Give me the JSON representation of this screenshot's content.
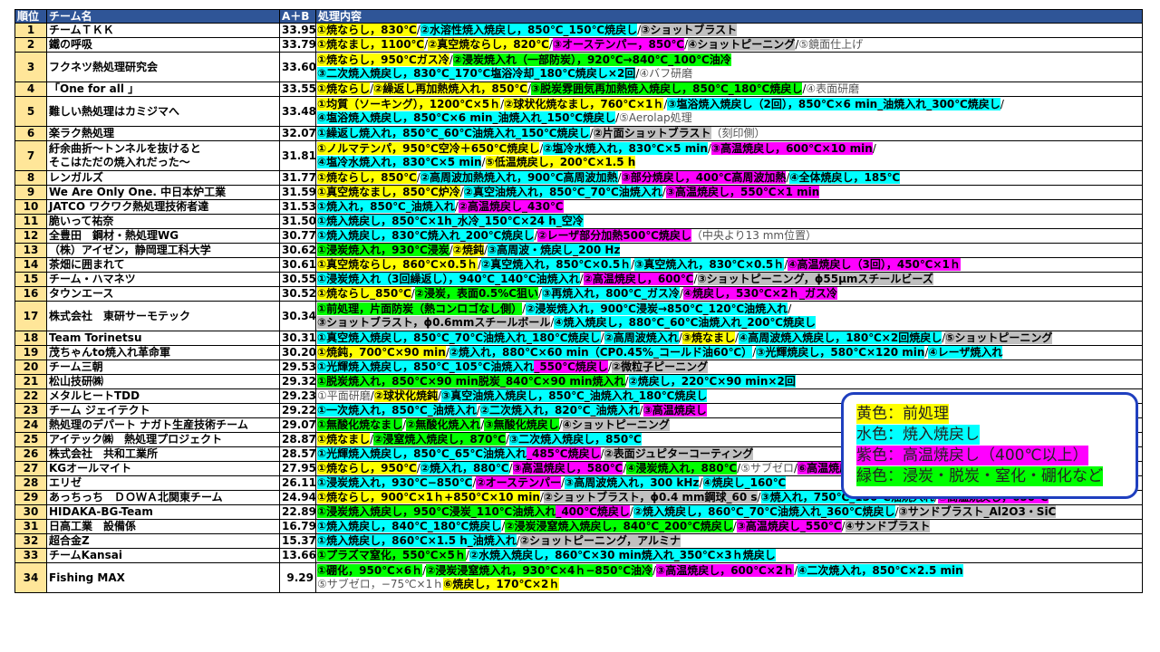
{
  "headers": {
    "rank": "順位",
    "team": "チーム名",
    "score": "A＋B",
    "process": "処理内容"
  },
  "colors": {
    "yellow": "#ffff00",
    "cyan": "#00ffff",
    "magenta": "#ff00ff",
    "green": "#00ff00",
    "gray": "#c0c0c0",
    "header": "#2f5597",
    "rank_bg": "#ffe699",
    "legend_border": "#1f3fbf"
  },
  "rows": [
    {
      "rank": "1",
      "team": "チームＴＫＫ",
      "score": "33.95",
      "lines": [
        [
          [
            "y",
            "①焼ならし，830℃"
          ],
          [
            "s",
            "/"
          ],
          [
            "c",
            "②水溶性焼入焼戻し，850℃_150℃焼戻し"
          ],
          [
            "s",
            "/"
          ],
          [
            "gr",
            "③ショットブラスト"
          ]
        ]
      ]
    },
    {
      "rank": "2",
      "team": "鐵の呼吸",
      "score": "33.79",
      "lines": [
        [
          [
            "y",
            "①焼なまし，1100℃"
          ],
          [
            "s",
            "/"
          ],
          [
            "y",
            "②真空焼ならし，820℃"
          ],
          [
            "s",
            "/"
          ],
          [
            "m",
            "③オーステンパー，850℃"
          ],
          [
            "s",
            "/"
          ],
          [
            "gr",
            "④ショットピーニング"
          ],
          [
            "s",
            "/"
          ],
          [
            "n",
            "⑤鏡面仕上げ"
          ]
        ]
      ]
    },
    {
      "rank": "3",
      "team": "フクネツ熱処理研究会",
      "score": "33.60",
      "lines": [
        [
          [
            "y",
            "①焼ならし，950℃ガス冷"
          ],
          [
            "s",
            "/"
          ],
          [
            "g",
            "②浸炭焼入れ（一部防炭），920℃→840℃_100℃油冷"
          ]
        ],
        [
          [
            "c",
            "③二次焼入焼戻し，830℃_170℃塩浴冷却_180℃焼戻し×2回"
          ],
          [
            "s",
            "/"
          ],
          [
            "n",
            "④バフ研磨"
          ]
        ]
      ]
    },
    {
      "rank": "4",
      "team": "「One for all 」",
      "score": "33.55",
      "lines": [
        [
          [
            "y",
            "①焼ならし"
          ],
          [
            "s",
            "/"
          ],
          [
            "y",
            "②繰返し再加熱焼入れ，850℃"
          ],
          [
            "s",
            "/"
          ],
          [
            "g",
            "③脱炭雰囲気再加熱焼入焼戻し，850℃_180℃焼戻し"
          ],
          [
            "s",
            "/"
          ],
          [
            "n",
            "④表面研磨"
          ]
        ]
      ]
    },
    {
      "rank": "5",
      "team": "難しい熱処理はカミジマへ",
      "score": "33.48",
      "lines": [
        [
          [
            "y",
            "①均質（ソーキング），1200℃×5ｈ"
          ],
          [
            "s",
            "/"
          ],
          [
            "y",
            "②球状化焼なまし，760℃×1ｈ"
          ],
          [
            "s",
            "/"
          ],
          [
            "c",
            "③塩浴焼入焼戻し（2回），850℃×6 min_油焼入れ_300℃焼戻し"
          ],
          [
            "s",
            "/"
          ]
        ],
        [
          [
            "c",
            "④塩浴焼入焼戻し，850℃×6 min_油焼入れ_150℃焼戻し"
          ],
          [
            "s",
            "/"
          ],
          [
            "n",
            "⑤Aerolap処理"
          ]
        ]
      ]
    },
    {
      "rank": "6",
      "team": "楽ラク熱処理",
      "score": "32.07",
      "lines": [
        [
          [
            "c",
            "①繰返し焼入れ，850℃_60℃油焼入れ_150℃焼戻し"
          ],
          [
            "s",
            "/"
          ],
          [
            "gr",
            "②片面ショットブラスト"
          ],
          [
            "n",
            "（刻印側）"
          ]
        ]
      ]
    },
    {
      "rank": "7",
      "team": "紆余曲折～トンネルを抜けると",
      "team2": "そこはただの焼入れだった～",
      "score": "31.81",
      "lines": [
        [
          [
            "y",
            "①ノルマテンパ，950℃空冷＋650℃焼戻し"
          ],
          [
            "s",
            "/"
          ],
          [
            "c",
            "②塩冷水焼入れ，830℃×5 min"
          ],
          [
            "s",
            "/"
          ],
          [
            "m",
            "③高温焼戻し，600℃×10 min"
          ],
          [
            "s",
            "/"
          ]
        ],
        [
          [
            "c",
            "④塩冷水焼入れ，830℃×5 min"
          ],
          [
            "s",
            "/"
          ],
          [
            "y",
            "⑤低温焼戻し，200℃×1.5 h"
          ]
        ]
      ]
    },
    {
      "rank": "8",
      "team": "レンガルズ",
      "score": "31.77",
      "lines": [
        [
          [
            "y",
            "①焼ならし，850℃"
          ],
          [
            "s",
            "/"
          ],
          [
            "c",
            "②高周波加熱焼入れ，900℃高周波加熱"
          ],
          [
            "s",
            "/"
          ],
          [
            "m",
            "③部分焼戻し，400℃高周波加熱"
          ],
          [
            "s",
            "/"
          ],
          [
            "c",
            "④全体焼戻し，185℃"
          ]
        ]
      ]
    },
    {
      "rank": "9",
      "team": "We Are Only One. 中日本炉工業",
      "score": "31.59",
      "lines": [
        [
          [
            "y",
            "①真空焼なまし，850℃炉冷"
          ],
          [
            "s",
            "/"
          ],
          [
            "c",
            "②真空油焼入れ，850℃_70℃油焼入れ"
          ],
          [
            "s",
            "/"
          ],
          [
            "m",
            "③高温焼戻し，550℃×1 min"
          ]
        ]
      ]
    },
    {
      "rank": "10",
      "team": "JATCO ワクワク熱処理技術者達",
      "score": "31.53",
      "lines": [
        [
          [
            "c",
            "①焼入れ，850℃_油焼入れ"
          ],
          [
            "s",
            "/"
          ],
          [
            "m",
            "②高温焼戻し_430℃"
          ]
        ]
      ]
    },
    {
      "rank": "11",
      "team": "脆いって祐奈",
      "score": "31.50",
      "lines": [
        [
          [
            "c",
            "①焼入焼戻し，850℃×1h_水冷_150℃×24 h_空冷"
          ]
        ]
      ]
    },
    {
      "rank": "12",
      "team": "全豊田　鋼材・熱処理WG",
      "score": "30.77",
      "lines": [
        [
          [
            "c",
            "①焼入焼戻し，830℃焼入れ_200℃焼戻し"
          ],
          [
            "s",
            "/"
          ],
          [
            "m",
            "②レーザ部分加熱500℃焼戻し"
          ],
          [
            "n",
            "（中央より13 mm位置）"
          ]
        ]
      ]
    },
    {
      "rank": "13",
      "team": "（株）アイゼン，静岡理工科大学",
      "score": "30.62",
      "lines": [
        [
          [
            "g",
            "①浸炭焼入れ，930℃浸炭"
          ],
          [
            "s",
            "/"
          ],
          [
            "y",
            "②焼鈍"
          ],
          [
            "s",
            "/"
          ],
          [
            "c",
            "③高周波・焼戻し_200 Hz"
          ]
        ]
      ]
    },
    {
      "rank": "14",
      "team": "茶畑に囲まれて",
      "score": "30.61",
      "lines": [
        [
          [
            "y",
            "①真空焼ならし，860℃×0.5ｈ"
          ],
          [
            "s",
            "/"
          ],
          [
            "c",
            "②真空焼入れ，850℃×0.5ｈ"
          ],
          [
            "s",
            "/"
          ],
          [
            "c",
            "③真空焼入れ，830℃×0.5ｈ"
          ],
          [
            "s",
            "/"
          ],
          [
            "m",
            "④高温焼戻し（3回），450℃×1ｈ"
          ]
        ]
      ]
    },
    {
      "rank": "15",
      "team": "チーム・ハマネツ",
      "score": "30.55",
      "lines": [
        [
          [
            "c",
            "①浸炭焼入れ（3回繰返し），940℃_140℃油焼入れ"
          ],
          [
            "s",
            "/"
          ],
          [
            "m",
            "②高温焼戻し，600℃"
          ],
          [
            "s",
            "/"
          ],
          [
            "gr",
            "③ショットピーニング，ϕ55μmスチールビーズ"
          ]
        ]
      ]
    },
    {
      "rank": "16",
      "team": "タウンエース",
      "score": "30.52",
      "lines": [
        [
          [
            "y",
            "①焼ならし_850℃"
          ],
          [
            "s",
            "/"
          ],
          [
            "g",
            "②浸炭，表面0.5%C狙い"
          ],
          [
            "s",
            "/"
          ],
          [
            "c",
            "③再焼入れ，800℃_ガス冷"
          ],
          [
            "s",
            "/"
          ],
          [
            "m",
            "④焼戻し，530℃×2ｈ_ガス冷"
          ]
        ]
      ]
    },
    {
      "rank": "17",
      "team": "株式会社　東研サーモテック",
      "score": "30.34",
      "lines": [
        [
          [
            "g",
            "①前処理，片面防炭（熱コンロゴなし側）"
          ],
          [
            "s",
            "/"
          ],
          [
            "c",
            "②浸炭焼入れ，900℃浸炭→850℃_120℃油焼入れ"
          ],
          [
            "s",
            "/"
          ]
        ],
        [
          [
            "gr",
            "③ショットブラスト，ϕ0.6mmスチールボール"
          ],
          [
            "s",
            "/"
          ],
          [
            "c",
            "④焼入焼戻し，880℃_60℃油焼入れ_200℃焼戻し"
          ]
        ]
      ]
    },
    {
      "rank": "18",
      "team": "Team Torinetsu",
      "score": "30.31",
      "lines": [
        [
          [
            "c",
            "①真空焼入焼戻し，850℃_70℃油焼入れ_180℃焼戻し"
          ],
          [
            "s",
            "/"
          ],
          [
            "c",
            "②高周波焼入れ"
          ],
          [
            "s",
            "/"
          ],
          [
            "y",
            "③焼なまし"
          ],
          [
            "s",
            "/"
          ],
          [
            "c",
            "④高周波焼入焼戻し，180℃×2回焼戻し"
          ],
          [
            "s",
            "/"
          ],
          [
            "gr",
            "⑤ショットピーニング"
          ]
        ]
      ]
    },
    {
      "rank": "19",
      "team": "茂ちゃんto焼入れ革命軍",
      "score": "30.20",
      "lines": [
        [
          [
            "y",
            "①焼鈍，700℃×90 min"
          ],
          [
            "s",
            "/"
          ],
          [
            "c",
            "②焼入れ，880℃×60 min（CP0.45%_コールド油60℃）"
          ],
          [
            "s",
            "/"
          ],
          [
            "c",
            "③光輝焼戻し，580℃×120 min"
          ],
          [
            "s",
            "/"
          ],
          [
            "c",
            "④レーザ焼入れ"
          ]
        ]
      ]
    },
    {
      "rank": "20",
      "team": "チーム三朝",
      "score": "29.53",
      "lines": [
        [
          [
            "c",
            "①光輝焼入焼戻し，850℃_105℃油焼入れ"
          ],
          [
            "m",
            "_550℃焼戻し"
          ],
          [
            "s",
            "/"
          ],
          [
            "gr",
            "②微粒子ピーニング"
          ]
        ]
      ]
    },
    {
      "rank": "21",
      "team": "松山技研㈱",
      "score": "29.32",
      "lines": [
        [
          [
            "g",
            "①脱炭焼入れ，850℃×90 min脱炭_840℃×90 min焼入れ"
          ],
          [
            "s",
            "/"
          ],
          [
            "c",
            "②焼戻し，220℃×90 min×2回"
          ]
        ]
      ]
    },
    {
      "rank": "22",
      "team": "メタルヒートTDD",
      "score": "29.23",
      "lines": [
        [
          [
            "n",
            "①平面研磨"
          ],
          [
            "s",
            "/"
          ],
          [
            "y",
            "②球状化焼鈍"
          ],
          [
            "s",
            "/"
          ],
          [
            "c",
            "③真空油焼入焼戻し，850℃_油焼入れ_180℃焼戻し"
          ]
        ]
      ]
    },
    {
      "rank": "23",
      "team": "チーム ジェイテクト",
      "score": "29.22",
      "lines": [
        [
          [
            "c",
            "①一次焼入れ，850℃_油焼入れ"
          ],
          [
            "s",
            "/"
          ],
          [
            "c",
            "②二次焼入れ，820℃_油焼入れ"
          ],
          [
            "s",
            "/"
          ],
          [
            "m",
            "③高温焼戻し"
          ]
        ]
      ]
    },
    {
      "rank": "24",
      "team": "熱処理のデパート ナガト生産技術チーム",
      "score": "29.07",
      "lines": [
        [
          [
            "g",
            "①無酸化焼なまし"
          ],
          [
            "s",
            "/"
          ],
          [
            "g",
            "②無酸化焼入れ"
          ],
          [
            "s",
            "/"
          ],
          [
            "g",
            "③無酸化焼戻し"
          ],
          [
            "s",
            "/"
          ],
          [
            "gr",
            "④ショットピーニング"
          ]
        ]
      ]
    },
    {
      "rank": "25",
      "team": "アイテック㈱　熱処理プロジェクト",
      "score": "28.87",
      "lines": [
        [
          [
            "y",
            "①焼なまし"
          ],
          [
            "s",
            "/"
          ],
          [
            "g",
            "②浸窒焼入焼戻し，870℃"
          ],
          [
            "s",
            "/"
          ],
          [
            "c",
            "③二次焼入焼戻し，850℃"
          ]
        ]
      ]
    },
    {
      "rank": "26",
      "team": "株式会社　共和工業所",
      "score": "28.57",
      "lines": [
        [
          [
            "c",
            "①光輝焼入焼戻し，850℃_65℃油焼入れ"
          ],
          [
            "m",
            "_485℃焼戻し"
          ],
          [
            "s",
            "/"
          ],
          [
            "gr",
            "②表面ジュピターコーティング"
          ]
        ]
      ]
    },
    {
      "rank": "27",
      "team": "KGオールマイト",
      "score": "27.95",
      "lines": [
        [
          [
            "y",
            "①焼ならし，950℃"
          ],
          [
            "s",
            "/"
          ],
          [
            "c",
            "②焼入れ，880℃"
          ],
          [
            "s",
            "/"
          ],
          [
            "m",
            "③高温焼戻し，580℃"
          ],
          [
            "s",
            "/"
          ],
          [
            "g",
            "④浸炭焼入れ，880℃"
          ],
          [
            "s",
            "/"
          ],
          [
            "n",
            "⑤サブゼロ"
          ],
          [
            "s",
            "/"
          ],
          [
            "m",
            "⑥高温焼戻し_630℃"
          ]
        ]
      ]
    },
    {
      "rank": "28",
      "team": "エリゼ",
      "score": "26.11",
      "lines": [
        [
          [
            "c",
            "①浸炭焼入れ，930℃−850℃"
          ],
          [
            "s",
            "/"
          ],
          [
            "m",
            "②オーステンパー"
          ],
          [
            "s",
            "/"
          ],
          [
            "c",
            "③高周波焼入れ，300 kHz"
          ],
          [
            "s",
            "/"
          ],
          [
            "c",
            "④焼戻し_160℃"
          ]
        ]
      ]
    },
    {
      "rank": "29",
      "team": "あっちっち　ＤＯＷＡ北関東チーム",
      "score": "24.94",
      "lines": [
        [
          [
            "y",
            "①焼ならし，900℃×1ｈ+850℃×10 min"
          ],
          [
            "s",
            "/"
          ],
          [
            "gr",
            "②ショットブラスト，ϕ0.4 mm鋼球_60 s"
          ],
          [
            "s",
            "/"
          ],
          [
            "c",
            "③焼入れ，750℃_130℃油焼入れ"
          ],
          [
            "s",
            "/"
          ],
          [
            "m",
            "④高温焼戻し，650℃"
          ]
        ]
      ]
    },
    {
      "rank": "30",
      "team": "HIDAKA-BG-Team",
      "score": "22.89",
      "lines": [
        [
          [
            "g",
            "①浸炭焼入焼戻し，950℃浸炭_110℃油焼入れ"
          ],
          [
            "m",
            "_400℃焼戻し"
          ],
          [
            "s",
            "/"
          ],
          [
            "c",
            "②焼入焼戻し，860℃_70℃油焼入れ_360℃焼戻し"
          ],
          [
            "s",
            "/"
          ],
          [
            "gr",
            "③サンドブラスト_Al2O3・SiC"
          ]
        ]
      ]
    },
    {
      "rank": "31",
      "team": "日高工業　設備係",
      "score": "16.79",
      "lines": [
        [
          [
            "c",
            "①焼入焼戻し，840℃_180℃焼戻し"
          ],
          [
            "s",
            "/"
          ],
          [
            "g",
            "②浸炭浸窒焼入焼戻し，840℃_200℃焼戻し"
          ],
          [
            "s",
            "/"
          ],
          [
            "m",
            "③高温焼戻し_550℃"
          ],
          [
            "s",
            "/"
          ],
          [
            "gr",
            "④サンドブラスト"
          ]
        ]
      ]
    },
    {
      "rank": "32",
      "team": "超合金Z",
      "score": "15.37",
      "lines": [
        [
          [
            "c",
            "①焼入焼戻し，860℃×1.5 h_油焼入れ"
          ],
          [
            "s",
            "/"
          ],
          [
            "gr",
            "②ショットピーニング，アルミナ"
          ]
        ]
      ]
    },
    {
      "rank": "33",
      "team": "チームKansai",
      "score": "13.66",
      "lines": [
        [
          [
            "g",
            "①プラズマ窒化，550℃×5ｈ"
          ],
          [
            "s",
            "/"
          ],
          [
            "c",
            "②水焼入焼戻し，860℃×30 min焼入れ_350℃×3ｈ焼戻し"
          ]
        ]
      ]
    },
    {
      "rank": "34",
      "team": "Fishing MAX",
      "score": "9.29",
      "lines": [
        [
          [
            "g",
            "①硼化，950℃×6ｈ"
          ],
          [
            "s",
            "/"
          ],
          [
            "g",
            "②浸炭浸窒焼入れ，930℃×4ｈ−850℃油冷"
          ],
          [
            "s",
            "/"
          ],
          [
            "m",
            "③高温焼戻し，600℃×2ｈ"
          ],
          [
            "s",
            "/"
          ],
          [
            "c",
            "④二次焼入れ，850℃×2.5 min"
          ]
        ],
        [
          [
            "n",
            "⑤サブゼロ，−75℃×1ｈ"
          ],
          [
            "y",
            "⑥焼戻し，170℃×2ｈ"
          ]
        ]
      ]
    }
  ],
  "legend": [
    {
      "label": "黄色：前処理",
      "color": "#ffff00"
    },
    {
      "label": "水色：焼入焼戻し",
      "color": "#00ffff"
    },
    {
      "label": "紫色：高温焼戻し（400℃以上）",
      "color": "#ff00ff"
    },
    {
      "label": "緑色：浸炭・脱炭・窒化・硼化など",
      "color": "#00ff00"
    }
  ]
}
